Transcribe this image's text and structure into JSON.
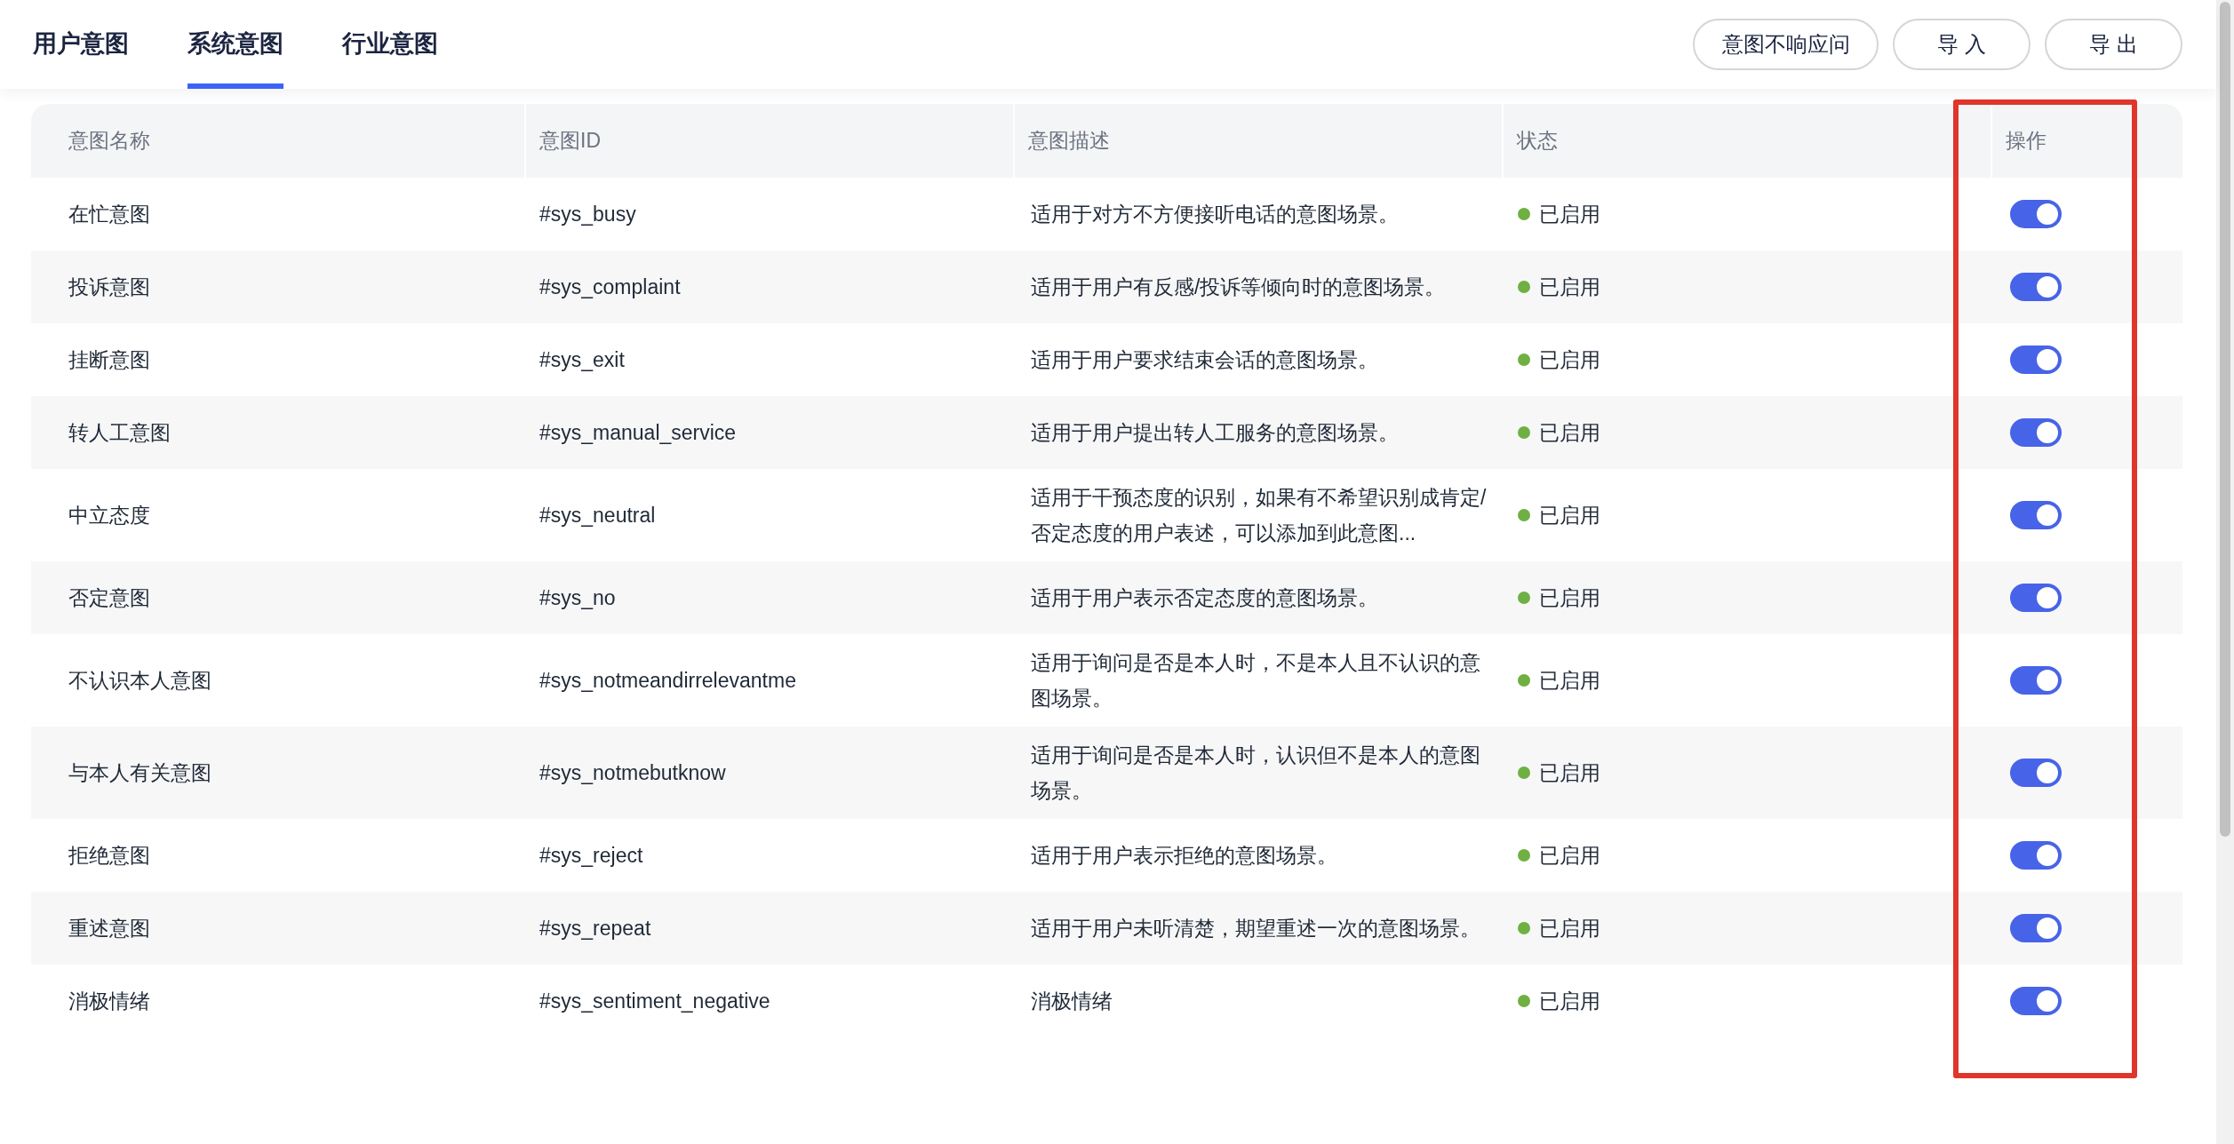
{
  "tabs": [
    {
      "label": "用户意图",
      "selected": false
    },
    {
      "label": "系统意图",
      "selected": true
    },
    {
      "label": "行业意图",
      "selected": false
    }
  ],
  "buttons": [
    "意图不响应问",
    "导 入",
    "导 出"
  ],
  "table": {
    "columns": [
      "意图名称",
      "意图ID",
      "意图描述",
      "状态",
      "操作"
    ],
    "rows": [
      {
        "name": "在忙意图",
        "id": "#sys_busy",
        "description": "适用于对方不方便接听电话的意图场景。",
        "status": "已启用",
        "color": "#6fb043",
        "on": true
      },
      {
        "name": "投诉意图",
        "id": "#sys_complaint",
        "description": "适用于用户有反感/投诉等倾向时的意图场景。",
        "status": "已启用",
        "color": "#6fb043",
        "on": true
      },
      {
        "name": "挂断意图",
        "id": "#sys_exit",
        "description": "适用于用户要求结束会话的意图场景。",
        "status": "已启用",
        "color": "#6fb043",
        "on": true
      },
      {
        "name": "转人工意图",
        "id": "#sys_manual_service",
        "description": "适用于用户提出转人工服务的意图场景。",
        "status": "已启用",
        "color": "#6fb043",
        "on": true
      },
      {
        "name": "中立态度",
        "id": "#sys_neutral",
        "description": "适用于干预态度的识别，如果有不希望识别成肯定/否定态度的用户表述，可以添加到此意图...",
        "status": "已启用",
        "color": "#6fb043",
        "on": true
      },
      {
        "name": "否定意图",
        "id": "#sys_no",
        "description": "适用于用户表示否定态度的意图场景。",
        "status": "已启用",
        "color": "#6fb043",
        "on": true
      },
      {
        "name": "不认识本人意图",
        "id": "#sys_notmeandirrelevantme",
        "description": "适用于询问是否是本人时，不是本人且不认识的意图场景。",
        "status": "已启用",
        "color": "#6fb043",
        "on": true
      },
      {
        "name": "与本人有关意图",
        "id": "#sys_notmebutknow",
        "description": "适用于询问是否是本人时，认识但不是本人的意图场景。",
        "status": "已启用",
        "color": "#6fb043",
        "on": true
      },
      {
        "name": "拒绝意图",
        "id": "#sys_reject",
        "description": "适用于用户表示拒绝的意图场景。",
        "status": "已启用",
        "color": "#6fb043",
        "on": true
      },
      {
        "name": "重述意图",
        "id": "#sys_repeat",
        "description": "适用于用户未听清楚，期望重述一次的意图场景。",
        "status": "已启用",
        "color": "#6fb043",
        "on": true
      },
      {
        "name": "消极情绪",
        "id": "#sys_sentiment_negative",
        "description": "消极情绪",
        "status": "已启用",
        "color": "#6fb043",
        "on": true
      }
    ]
  }
}
